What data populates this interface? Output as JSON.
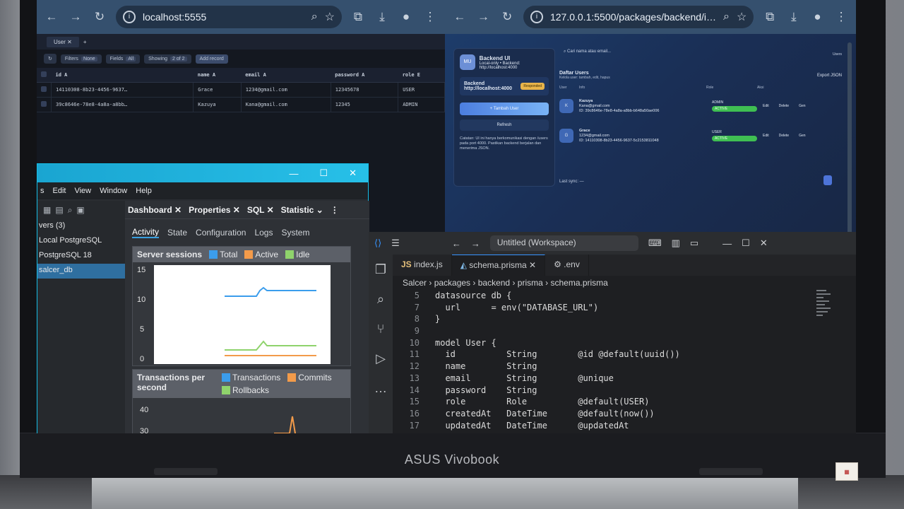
{
  "device": {
    "brand": "ASUS Vivobook"
  },
  "browser_left": {
    "url": "localhost:5555",
    "studio": {
      "tab_label": "User",
      "filters_label": "Filters",
      "filters_value": "None",
      "fields_label": "Fields",
      "fields_value": "All",
      "showing_label": "Showing",
      "showing_value": "2 of 2",
      "add_record": "Add record",
      "columns": [
        "id A",
        "name A",
        "email A",
        "password A",
        "role E"
      ],
      "rows": [
        [
          "14110308-8b23-4456-9637…",
          "Grace",
          "1234@gmail.com",
          "12345678",
          "USER"
        ],
        [
          "39c8646e-78e8-4a8a-a8bb…",
          "Kazuya",
          "Kana@gmail.com",
          "12345",
          "ADMIN"
        ]
      ]
    }
  },
  "browser_right": {
    "url": "127.0.0.1:5500/packages/backend/i…",
    "app": {
      "logo": "MU",
      "title": "Backend UI",
      "subtitle": "Local-only • Backend:",
      "subtitle_url": "http://localhost:4000",
      "backend_label": "Backend",
      "backend_url": "http://localhost:4000",
      "status_badge": "Responded",
      "add_user": "+ Tambah User",
      "refresh": "Refresh",
      "note": "Catatan: UI ini hanya berkomunikasi dengan /users pada port 4000. Pastikan backend berjalan dan menerima JSON.",
      "search_placeholder": "Cari nama atau email...",
      "users_link": "Users",
      "list_title": "Daftar Users",
      "list_subtitle": "Kelola user: tambah, edit, hapus",
      "export": "Export JSON",
      "cols": [
        "User",
        "Info",
        "Role",
        "Aksi"
      ],
      "users": [
        {
          "avatar": "K",
          "name": "Kazuya",
          "email": "Kana@gmail.com",
          "id": "ID: 39c8646e-78e8-4a8a-a8bb-b648a50ae006",
          "role": "ADMIN",
          "status": "ACTIVE"
        },
        {
          "avatar": "G",
          "name": "Grace",
          "email": "1234@gmail.com",
          "id": "ID: 14110308-8b23-4456-9637-5c2153811048",
          "role": "USER",
          "status": "ACTIVE"
        }
      ],
      "actions": [
        "Edit",
        "Delete",
        "Gen"
      ],
      "last_sync": "Last sync: —"
    }
  },
  "pgadmin": {
    "menu": [
      "s",
      "Edit",
      "View",
      "Window",
      "Help"
    ],
    "tree": [
      "vers (3)",
      "Local PostgreSQL",
      "PostgreSQL 18",
      "salcer_db"
    ],
    "tabs": [
      "Dashboard",
      "Properties",
      "SQL",
      "Statistic"
    ],
    "subtabs": [
      "Activity",
      "State",
      "Configuration",
      "Logs",
      "System"
    ],
    "sessions_title": "Server sessions",
    "sessions_legend": [
      "Total",
      "Active",
      "Idle"
    ],
    "sessions_ticks": [
      "15",
      "10",
      "5",
      "0"
    ],
    "tx_title": "Transactions per second",
    "tx_legend": [
      "Transactions",
      "Commits",
      "Rollbacks"
    ],
    "tx_ticks": [
      "40",
      "30"
    ],
    "colors": {
      "total": "#3b9dec",
      "active": "#f39b4a",
      "idle": "#8fd36c",
      "transactions": "#3b9dec",
      "commits": "#f39b4a",
      "rollbacks": "#8fd36c",
      "accent": "#1aa5d1"
    }
  },
  "vscode": {
    "search": "Untitled (Workspace)",
    "tabs": [
      "index.js",
      "schema.prisma",
      ".env"
    ],
    "breadcrumb": [
      "Salcer",
      "packages",
      "backend",
      "prisma",
      "schema.prisma"
    ],
    "lines": [
      {
        "n": "5",
        "c": "datasource db {"
      },
      {
        "n": "7",
        "c": "  url      = env(\"DATABASE_URL\")"
      },
      {
        "n": "8",
        "c": "}"
      },
      {
        "n": "9",
        "c": ""
      },
      {
        "n": "10",
        "c": "model User {"
      },
      {
        "n": "11",
        "c": "  id          String        @id @default(uuid())"
      },
      {
        "n": "12",
        "c": "  name        String"
      },
      {
        "n": "13",
        "c": "  email       String        @unique"
      },
      {
        "n": "14",
        "c": "  password    String"
      },
      {
        "n": "15",
        "c": "  role        Role          @default(USER)"
      },
      {
        "n": "16",
        "c": "  createdAt   DateTime      @default(now())"
      },
      {
        "n": "17",
        "c": "  updatedAt   DateTime      @updatedAt"
      }
    ]
  }
}
